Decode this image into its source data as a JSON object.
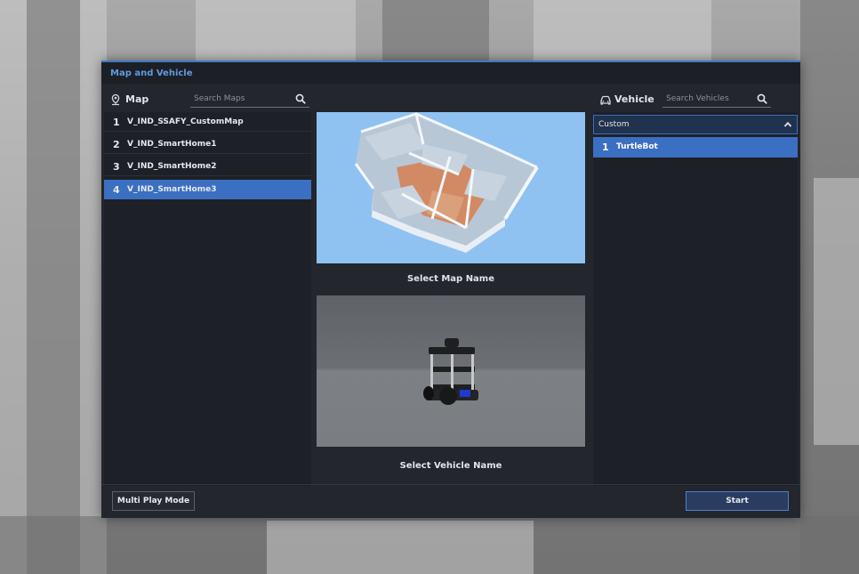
{
  "dialog": {
    "title": "Map and Vehicle"
  },
  "map_section": {
    "label": "Map",
    "search_placeholder": "Search Maps",
    "items": [
      {
        "num": "1",
        "name": "V_IND_SSAFY_CustomMap",
        "selected": false
      },
      {
        "num": "2",
        "name": "V_IND_SmartHome1",
        "selected": false
      },
      {
        "num": "3",
        "name": "V_IND_SmartHome2",
        "selected": false
      },
      {
        "num": "4",
        "name": "V_IND_SmartHome3",
        "selected": true
      }
    ]
  },
  "preview": {
    "map_caption": "Select Map  Name",
    "vehicle_caption": "Select Vehicle Name"
  },
  "vehicle_section": {
    "label": "Vehicle",
    "search_placeholder": "Search Vehicles",
    "category": "Custom",
    "items": [
      {
        "num": "1",
        "name": "TurtleBot",
        "selected": true
      }
    ]
  },
  "footer": {
    "multi_play_label": "Multi Play Mode",
    "start_label": "Start"
  },
  "colors": {
    "accent": "#3b6fc2",
    "title_text": "#5e9be0",
    "dialog_bg": "#23262d",
    "panel_bg": "#1d2026"
  },
  "icons": {
    "map_section": "map-pin-icon",
    "vehicle_section": "car-icon",
    "search": "search-icon",
    "dropdown": "chevron-up-icon"
  }
}
